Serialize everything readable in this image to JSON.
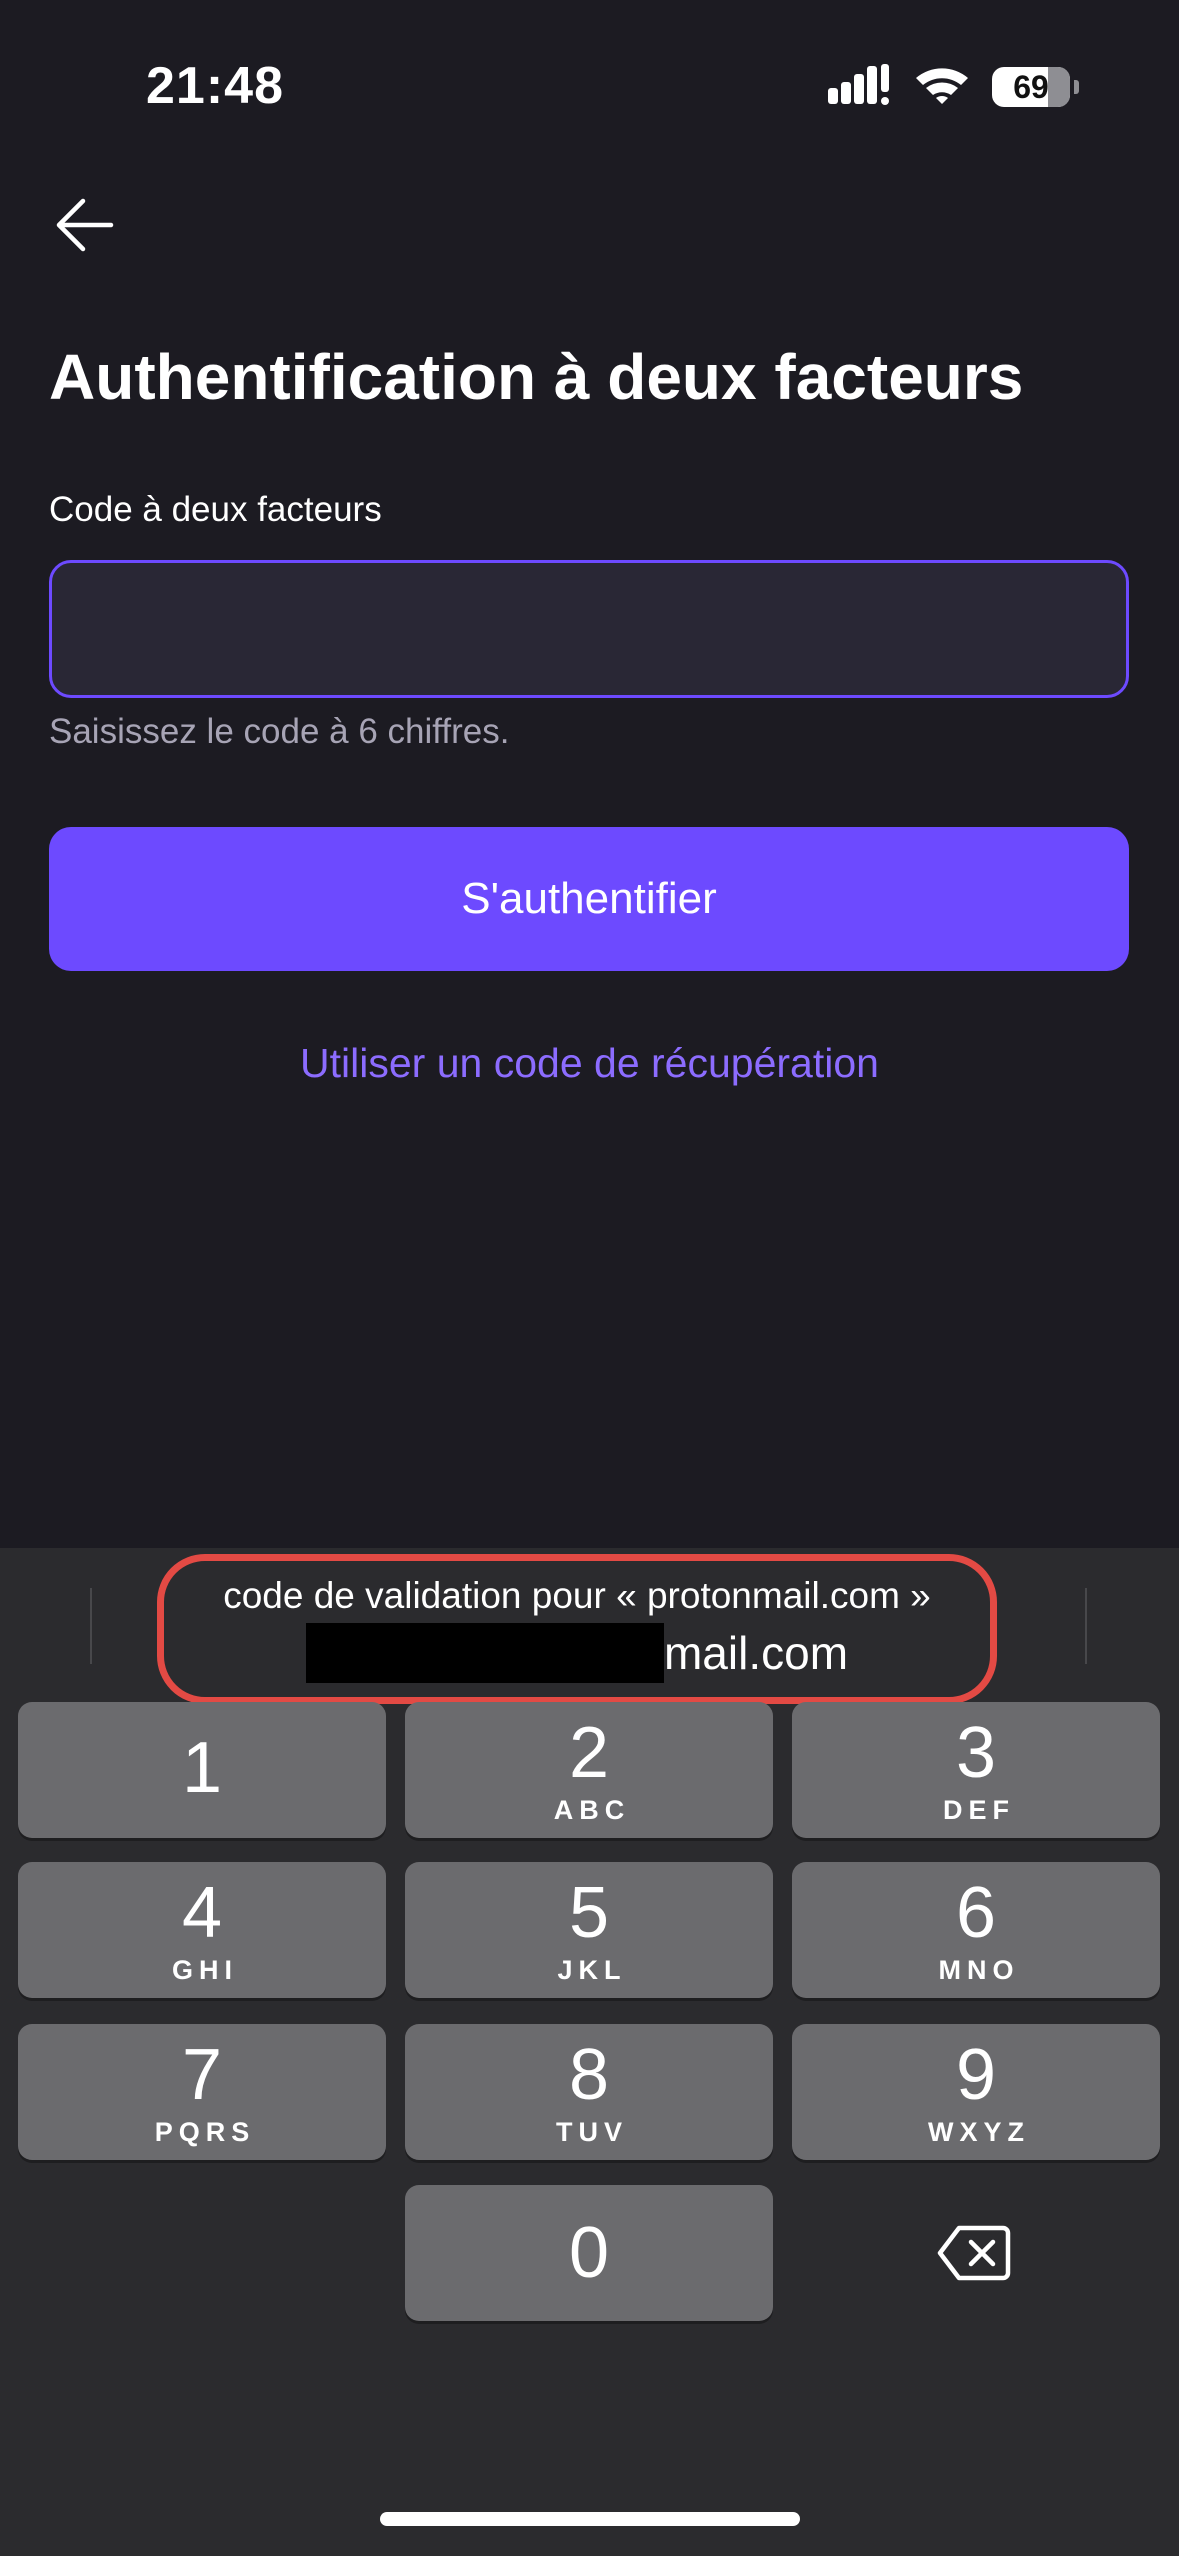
{
  "status_bar": {
    "time": "21:48",
    "battery": "69"
  },
  "header": {
    "title": "Authentification à deux facteurs"
  },
  "form": {
    "field_label": "Code à deux facteurs",
    "field_value": "",
    "hint": "Saisissez le code à 6 chiffres.",
    "submit_label": "S'authentifier",
    "recovery_link": "Utiliser un code de récupération"
  },
  "colors": {
    "accent": "#6d4aff",
    "link": "#8c6cff",
    "background": "#1c1b22",
    "highlight_ring": "#e34a44"
  },
  "keyboard": {
    "suggestion": {
      "line1": "code de validation pour « protonmail.com »",
      "line2_suffix": "mail.com"
    },
    "keys": [
      {
        "digit": "1",
        "letters": ""
      },
      {
        "digit": "2",
        "letters": "ABC"
      },
      {
        "digit": "3",
        "letters": "DEF"
      },
      {
        "digit": "4",
        "letters": "GHI"
      },
      {
        "digit": "5",
        "letters": "JKL"
      },
      {
        "digit": "6",
        "letters": "MNO"
      },
      {
        "digit": "7",
        "letters": "PQRS"
      },
      {
        "digit": "8",
        "letters": "TUV"
      },
      {
        "digit": "9",
        "letters": "WXYZ"
      },
      {
        "digit": "0",
        "letters": ""
      }
    ]
  }
}
